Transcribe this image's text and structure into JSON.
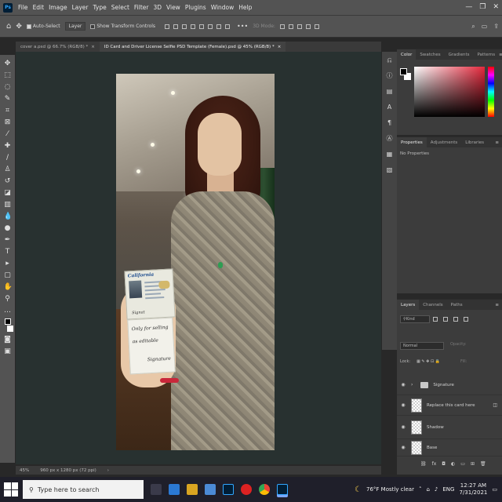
{
  "menubar": {
    "logo": "Ps",
    "items": [
      "File",
      "Edit",
      "Image",
      "Layer",
      "Type",
      "Select",
      "Filter",
      "3D",
      "View",
      "Plugins",
      "Window",
      "Help"
    ],
    "window_buttons": [
      "—",
      "❐",
      "✕"
    ]
  },
  "options": {
    "auto_select": "Auto-Select",
    "auto_select_target": "Layer",
    "show_transform": "Show Transform Controls",
    "mode3d": "3D Mode:"
  },
  "tabs": [
    {
      "label": "cover a.psd @ 66.7% (RGB/8) *",
      "active": false
    },
    {
      "label": "ID Card and Driver License Selfie PSD Template (Female).psd @ 45% (RGB/8) *",
      "active": true
    }
  ],
  "document": {
    "card_state": "California",
    "card_signature": "Signat",
    "handwriting": [
      "Only for selling",
      "as editable",
      "Signature"
    ]
  },
  "status": {
    "zoom": "45%",
    "size": "960 px x 1280 px (72 ppi)",
    "arrow": "›"
  },
  "panels": {
    "color_tabs": [
      "Color",
      "Swatches",
      "Gradients",
      "Patterns"
    ],
    "properties_tabs": [
      "Properties",
      "Adjustments",
      "Libraries"
    ],
    "no_properties": "No Properties",
    "layers_tabs": [
      "Layers",
      "Channels",
      "Paths"
    ],
    "kind": "Kind",
    "blend": "Normal",
    "opacity": "Opacity:",
    "lock": "Lock:",
    "fill": "Fill:",
    "layers": [
      {
        "name": "Signature",
        "type": "folder"
      },
      {
        "name": "Replace this card here",
        "type": "smart"
      },
      {
        "name": "Shadow",
        "type": "layer"
      },
      {
        "name": "Base",
        "type": "layer"
      }
    ]
  },
  "taskbar": {
    "search_placeholder": "Type here to search",
    "weather": "76°F  Mostly clear",
    "lang": "ENG",
    "time": "12:27 AM",
    "date": "7/31/2021"
  },
  "colors": {
    "accent": "#31a8ff",
    "ps_bg": "#001e36"
  }
}
